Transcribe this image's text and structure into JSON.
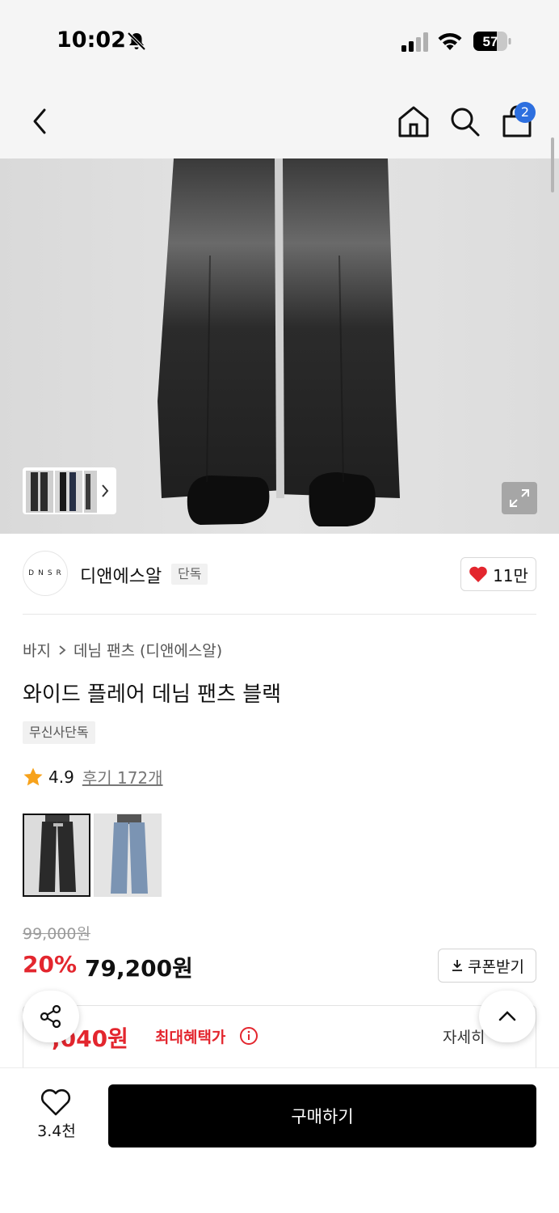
{
  "status_bar": {
    "time": "10:02",
    "battery": "57"
  },
  "nav": {
    "cart_count": "2"
  },
  "brand": {
    "logo_text": "DNSR",
    "name": "디앤에스알",
    "tag": "단독",
    "like_count": "11만"
  },
  "product": {
    "breadcrumb": [
      "바지",
      "데님 팬츠 (디앤에스알)"
    ],
    "title": "와이드 플레어 데님 팬츠 블랙",
    "exclusive_tag": "무신사단독",
    "rating": "4.9",
    "review_text": "후기 172개",
    "variants": [
      "black",
      "blue"
    ],
    "original_price": "99,000원",
    "discount_rate": "20%",
    "sale_price": "79,200원",
    "coupon_label": "쿠폰받기",
    "max_benefit_price": "71,040원",
    "max_benefit_price_visible": ",040원",
    "max_benefit_label": "최대혜택가",
    "detail_label": "자세히"
  },
  "bottom_bar": {
    "wishlist_count": "3.4천",
    "buy_label": "구매하기"
  },
  "colors": {
    "accent_red": "#e3262e",
    "badge_blue": "#2d6fdf",
    "buy_button": "#000000"
  }
}
